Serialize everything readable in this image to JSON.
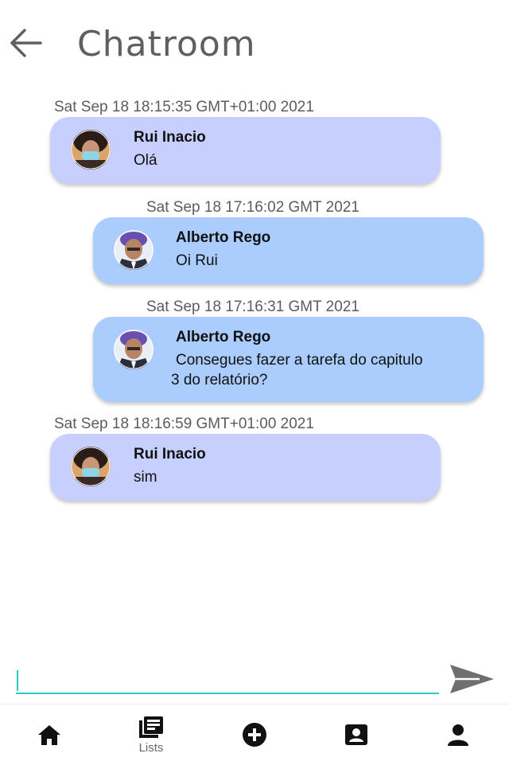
{
  "header": {
    "title": "Chatroom",
    "back_icon": "arrow-left-icon"
  },
  "messages": [
    {
      "timestamp": "Sat Sep 18 18:15:35 GMT+01:00 2021",
      "sender": "Rui Inacio",
      "text": "Olá",
      "side": "left",
      "bubble_color": "#c7cffe"
    },
    {
      "timestamp": "Sat Sep 18 17:16:02 GMT 2021",
      "sender": "Alberto Rego",
      "text": "Oi Rui",
      "side": "right",
      "bubble_color": "#aacdfe"
    },
    {
      "timestamp": "Sat Sep 18 17:16:31 GMT 2021",
      "sender": "Alberto Rego",
      "text": "Consegues fazer a tarefa do capitulo 3 do relatório?",
      "side": "right",
      "bubble_color": "#aacdfe"
    },
    {
      "timestamp": "Sat Sep 18 18:16:59 GMT+01:00 2021",
      "sender": "Rui Inacio",
      "text": "sim",
      "side": "left",
      "bubble_color": "#c7cffe"
    }
  ],
  "composer": {
    "value": "",
    "send_icon": "send-icon",
    "accent_color": "#2bc9c0"
  },
  "nav": {
    "items": [
      {
        "icon": "home-icon",
        "label": ""
      },
      {
        "icon": "lists-icon",
        "label": "Lists"
      },
      {
        "icon": "add-circle-icon",
        "label": ""
      },
      {
        "icon": "contact-card-icon",
        "label": ""
      },
      {
        "icon": "person-icon",
        "label": ""
      }
    ]
  }
}
